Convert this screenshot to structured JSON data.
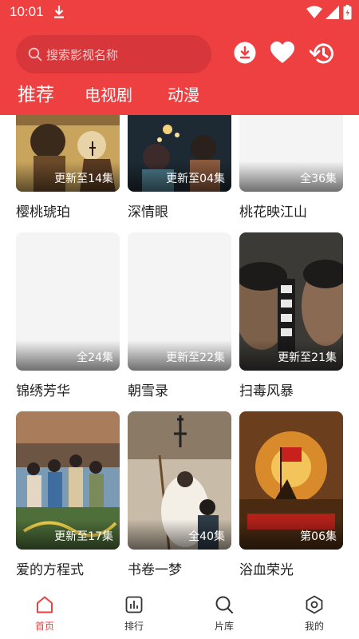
{
  "status_bar": {
    "time": "10:01"
  },
  "search": {
    "placeholder": "搜索影视名称"
  },
  "header_icons": [
    "download-icon",
    "heart-icon",
    "history-icon"
  ],
  "tabs": [
    {
      "label": "推荐",
      "active": true
    },
    {
      "label": "电视剧",
      "active": false
    },
    {
      "label": "动漫",
      "active": false
    }
  ],
  "cards": [
    {
      "title": "樱桃琥珀",
      "badge": "更新至14集"
    },
    {
      "title": "深情眼",
      "badge": "更新至04集"
    },
    {
      "title": "桃花映江山",
      "badge": "全36集"
    },
    {
      "title": "锦绣芳华",
      "badge": "全24集"
    },
    {
      "title": "朝雪录",
      "badge": "更新至22集"
    },
    {
      "title": "扫毒风暴",
      "badge": "更新至21集"
    },
    {
      "title": "爱的方程式",
      "badge": "更新至17集"
    },
    {
      "title": "书卷一梦",
      "badge": "全40集"
    },
    {
      "title": "浴血荣光",
      "badge": "第06集"
    }
  ],
  "bottom_nav": [
    {
      "label": "首页",
      "icon": "home-icon",
      "active": true
    },
    {
      "label": "排行",
      "icon": "chart-icon",
      "active": false
    },
    {
      "label": "片库",
      "icon": "search-icon",
      "active": false
    },
    {
      "label": "我的",
      "icon": "profile-icon",
      "active": false
    }
  ],
  "colors": {
    "accent": "#ee3f41",
    "search_bg": "#d7373a"
  }
}
